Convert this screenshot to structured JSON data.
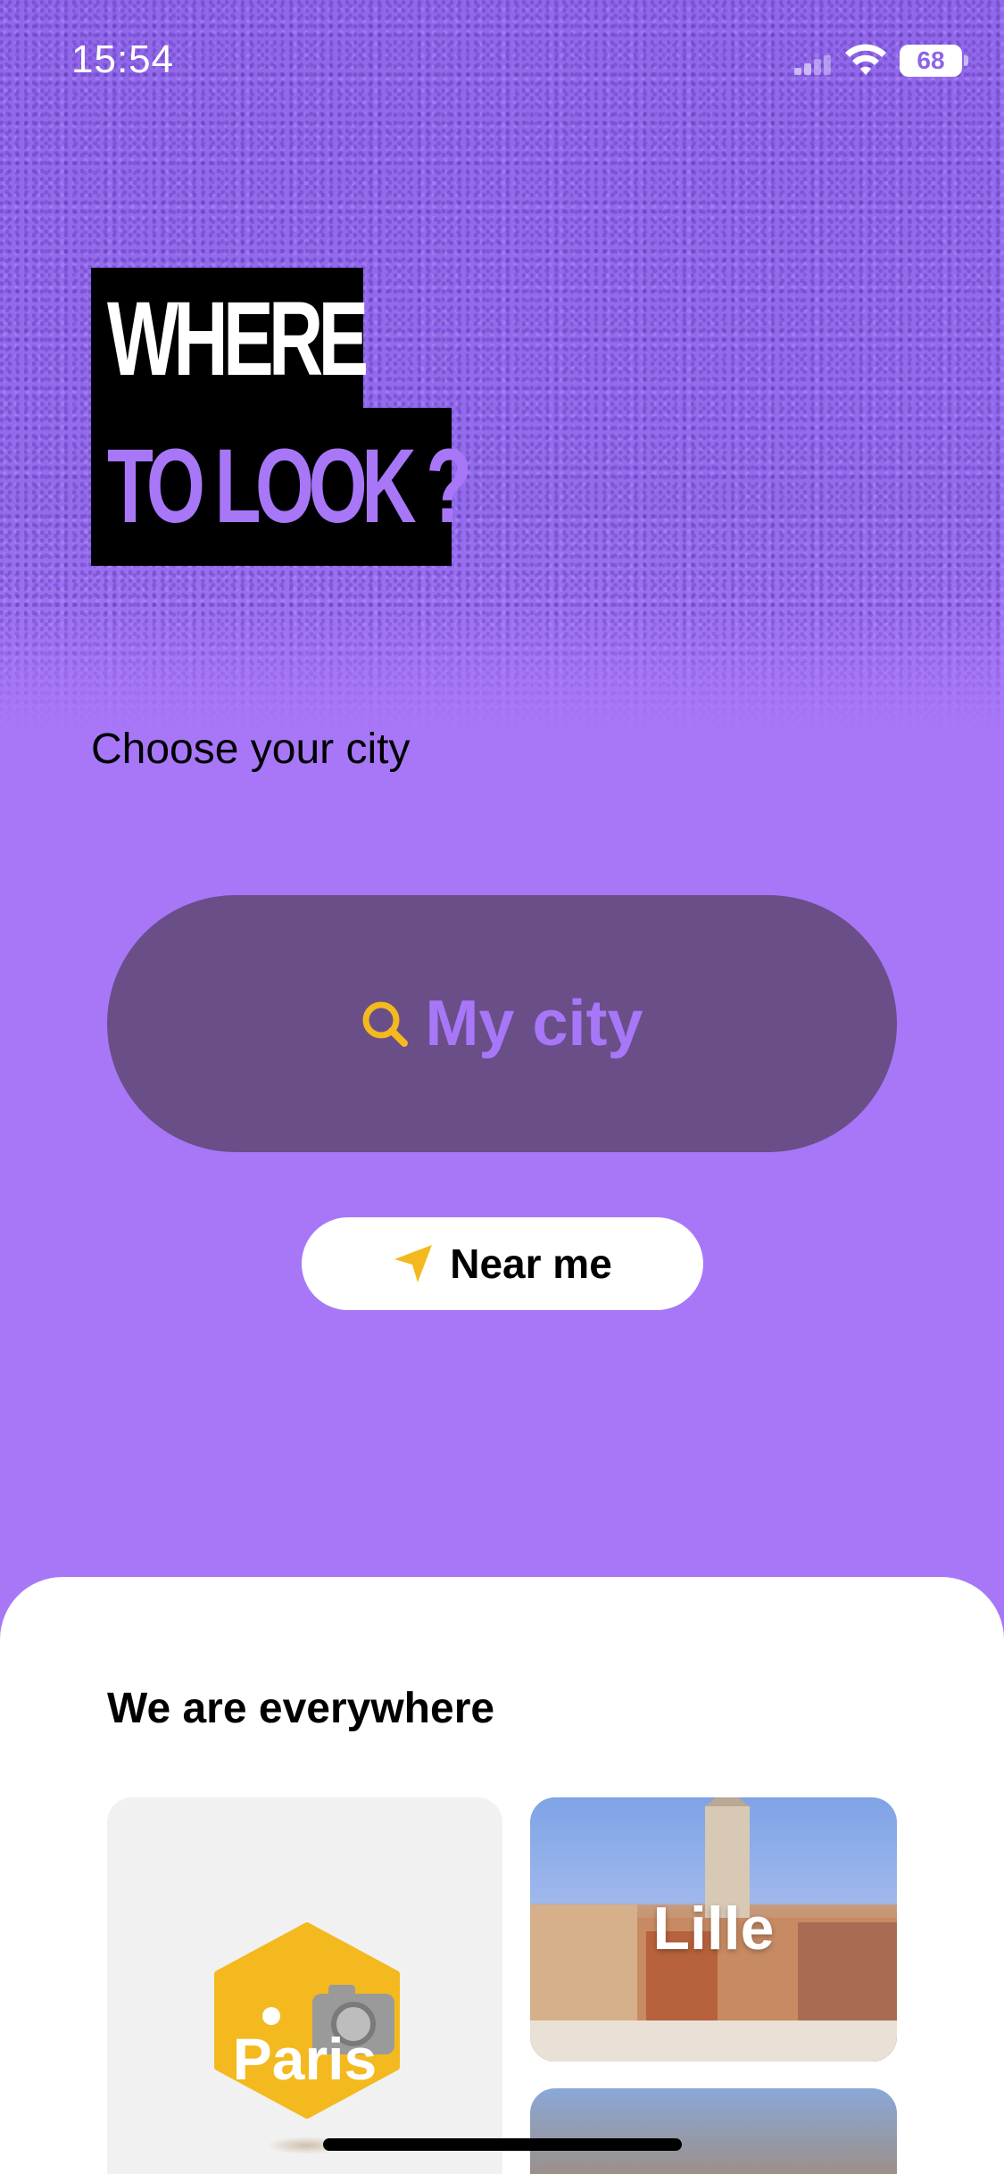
{
  "status_bar": {
    "time": "15:54",
    "battery": "68"
  },
  "logo": {
    "line1": "WHERE",
    "line2": "TO LOOK ?"
  },
  "subtitle": "Choose your city",
  "search": {
    "label": "My city",
    "icon": "search-icon"
  },
  "near_me": {
    "label": "Near me",
    "icon": "location-arrow-icon"
  },
  "sheet": {
    "title": "We are everywhere",
    "cities": [
      {
        "label": "Paris"
      },
      {
        "label": "Lille"
      }
    ]
  },
  "colors": {
    "background": "#a777f8",
    "search_button": "#6a4e88",
    "accent_yellow": "#f3b91e"
  }
}
